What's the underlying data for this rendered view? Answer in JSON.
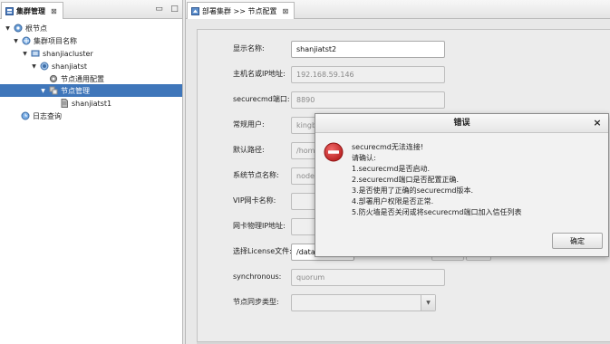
{
  "left_panel": {
    "tab_label": "集群管理",
    "tab_close": "⊠",
    "controls": {
      "minimize": "▭",
      "maximize": "□"
    },
    "tree": [
      {
        "label": "根节点",
        "toggle": "▼",
        "icon": "root-node-icon"
      },
      {
        "label": "集群项目名称",
        "toggle": "▼",
        "icon": "project-icon"
      },
      {
        "label": "shanjiacluster",
        "toggle": "▼",
        "icon": "cluster-icon"
      },
      {
        "label": "shanjiatst",
        "toggle": "▼",
        "icon": "node-group-icon"
      },
      {
        "label": "节点通用配置",
        "toggle": "",
        "icon": "config-icon"
      },
      {
        "label": "节点管理",
        "toggle": "▼",
        "icon": "node-manage-icon",
        "selected": true
      },
      {
        "label": "shanjiatst1",
        "toggle": "",
        "icon": "node-file-icon"
      },
      {
        "label": "日志查询",
        "toggle": "",
        "icon": "log-icon"
      }
    ]
  },
  "right_panel": {
    "tab_label": "部署集群 >> 节点配置",
    "tab_close": "⊠"
  },
  "form": {
    "display_name": {
      "label": "显示名称:",
      "value": "shanjiatst2"
    },
    "host_ip": {
      "label": "主机名或IP地址:",
      "value": "192.168.59.146"
    },
    "securecmd_port": {
      "label": "securecmd端口:",
      "value": "8890"
    },
    "common_user": {
      "label": "常规用户:",
      "value": "kingbase"
    },
    "default_path": {
      "label": "默认路径:",
      "value": "/home/kin"
    },
    "system_node_name": {
      "label": "系统节点名称:",
      "value": "node2"
    },
    "vip_nic_name": {
      "label": "VIP网卡名称:",
      "value": ""
    },
    "nic_physical_ip": {
      "label": "网卡物理IP地址:",
      "value": ""
    },
    "license_file": {
      "label": "选择License文件:",
      "value": "/data/soft"
    },
    "synchronous": {
      "label": "synchronous:",
      "value": "quorum"
    },
    "sync_type": {
      "label": "节点同步类型:",
      "value": ""
    }
  },
  "dialog": {
    "title": "错误",
    "close": "×",
    "messages": [
      "securecmd无法连接!",
      "请确认:",
      "1.securecmd是否启动.",
      "2.securecmd端口是否配置正确.",
      "3.是否使用了正确的securecmd版本.",
      "4.部署用户权限是否正常.",
      "5.防火墙是否关闭或将securecmd端口加入信任列表"
    ],
    "ok_label": "确定",
    "icon": "error-icon",
    "icon_color": "#d42a2a"
  },
  "colors": {
    "selection": "#3f76ba",
    "error_red": "#d42a2a"
  }
}
